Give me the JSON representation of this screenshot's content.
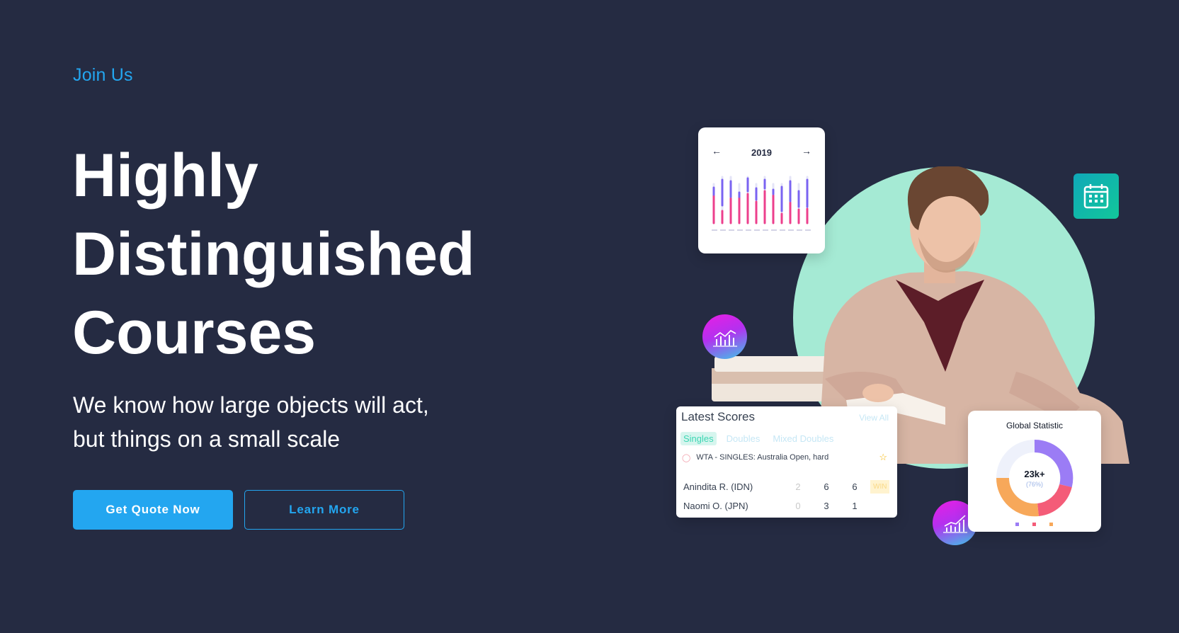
{
  "hero": {
    "eyebrow": "Join Us",
    "title_lines": [
      "Highly",
      "Distinguished",
      "Courses"
    ],
    "subtitle_lines": [
      "We know how large objects will act,",
      "but things on a small scale"
    ],
    "primary_button": "Get Quote Now",
    "secondary_button": "Learn More"
  },
  "illustration": {
    "year_card": {
      "year": "2019",
      "prev_arrow": "←",
      "next_arrow": "→"
    },
    "scores_card": {
      "title": "Latest Scores",
      "view_all": "View All",
      "tabs": [
        "Singles",
        "Doubles",
        "Mixed Doubles"
      ],
      "event": "WTA - SINGLES: Australia Open, hard",
      "rows": [
        {
          "name": "Anindita R. (IDN)",
          "s1": "2",
          "s2": "6",
          "s3": "6",
          "badge": "WIN"
        },
        {
          "name": "Naomi O. (JPN)",
          "s1": "0",
          "s2": "3",
          "s3": "1",
          "badge": ""
        }
      ]
    },
    "global_card": {
      "title": "Global Statistic",
      "value": "23k+",
      "sub": "(76%)"
    }
  },
  "colors": {
    "background": "#252b42",
    "accent": "#23a6f0",
    "mint": "#a5ead4"
  }
}
